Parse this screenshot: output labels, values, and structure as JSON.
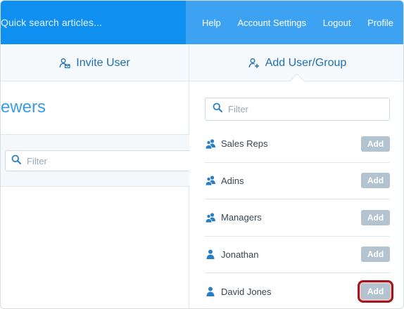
{
  "search": {
    "placeholder": "Quick search articles..."
  },
  "nav": {
    "help": "Help",
    "account_settings": "Account Settings",
    "logout": "Logout",
    "profile": "Profile"
  },
  "tabs": {
    "invite_user": "Invite User",
    "add_user_group": "Add User/Group"
  },
  "left": {
    "title": "ewers",
    "filter_placeholder": "Filter"
  },
  "right": {
    "filter_placeholder": "Filter"
  },
  "items": [
    {
      "label": "Sales Reps",
      "type": "group",
      "button": "Add"
    },
    {
      "label": "Adins",
      "type": "group",
      "button": "Add"
    },
    {
      "label": "Managers",
      "type": "group",
      "button": "Add"
    },
    {
      "label": "Jonathan",
      "type": "user",
      "button": "Add"
    },
    {
      "label": "David Jones",
      "type": "user",
      "button": "Add",
      "highlighted": true
    }
  ],
  "colors": {
    "topbar_left": "#0f8ff0",
    "topbar_right": "#3ea2f2",
    "accent": "#3a9ce6",
    "button": "#b3c3cf",
    "highlight": "#a3161e"
  }
}
